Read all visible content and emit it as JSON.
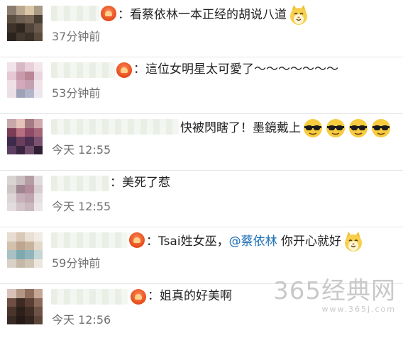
{
  "comments": [
    {
      "text_prefix": "：看蔡依林一本正经的胡说八道",
      "mention": "",
      "text_suffix": "",
      "time": "37分钟前",
      "emoji": [
        "cat-smile-icon"
      ]
    },
    {
      "text_prefix": "：這位女明星太可愛了～～～～～～～",
      "mention": "",
      "text_suffix": "",
      "time": "53分钟前",
      "emoji": []
    },
    {
      "text_prefix": "快被閃瞎了！墨鏡戴上",
      "mention": "",
      "text_suffix": "",
      "time": "今天 12:55",
      "emoji": [
        "sunglasses-face-icon",
        "sunglasses-face-icon",
        "sunglasses-face-icon",
        "sunglasses-face-icon"
      ]
    },
    {
      "text_prefix": "：美死了惹",
      "mention": "",
      "text_suffix": "",
      "time": "今天 12:55",
      "emoji": []
    },
    {
      "text_prefix": "：Tsai姓女巫，",
      "mention": "@蔡依林",
      "text_suffix": " 你开心就好",
      "time": "59分钟前",
      "emoji": [
        "cat-smile-icon"
      ]
    },
    {
      "text_prefix": "：姐真的好美啊",
      "mention": "",
      "text_suffix": "",
      "time": "今天 12:56",
      "emoji": []
    }
  ],
  "watermark": {
    "main": "365经典网",
    "url": "www.365j.com"
  },
  "colors": {
    "mention": "#1d6fb8",
    "time": "#6f6f6f",
    "divider": "#e6e6e6"
  }
}
